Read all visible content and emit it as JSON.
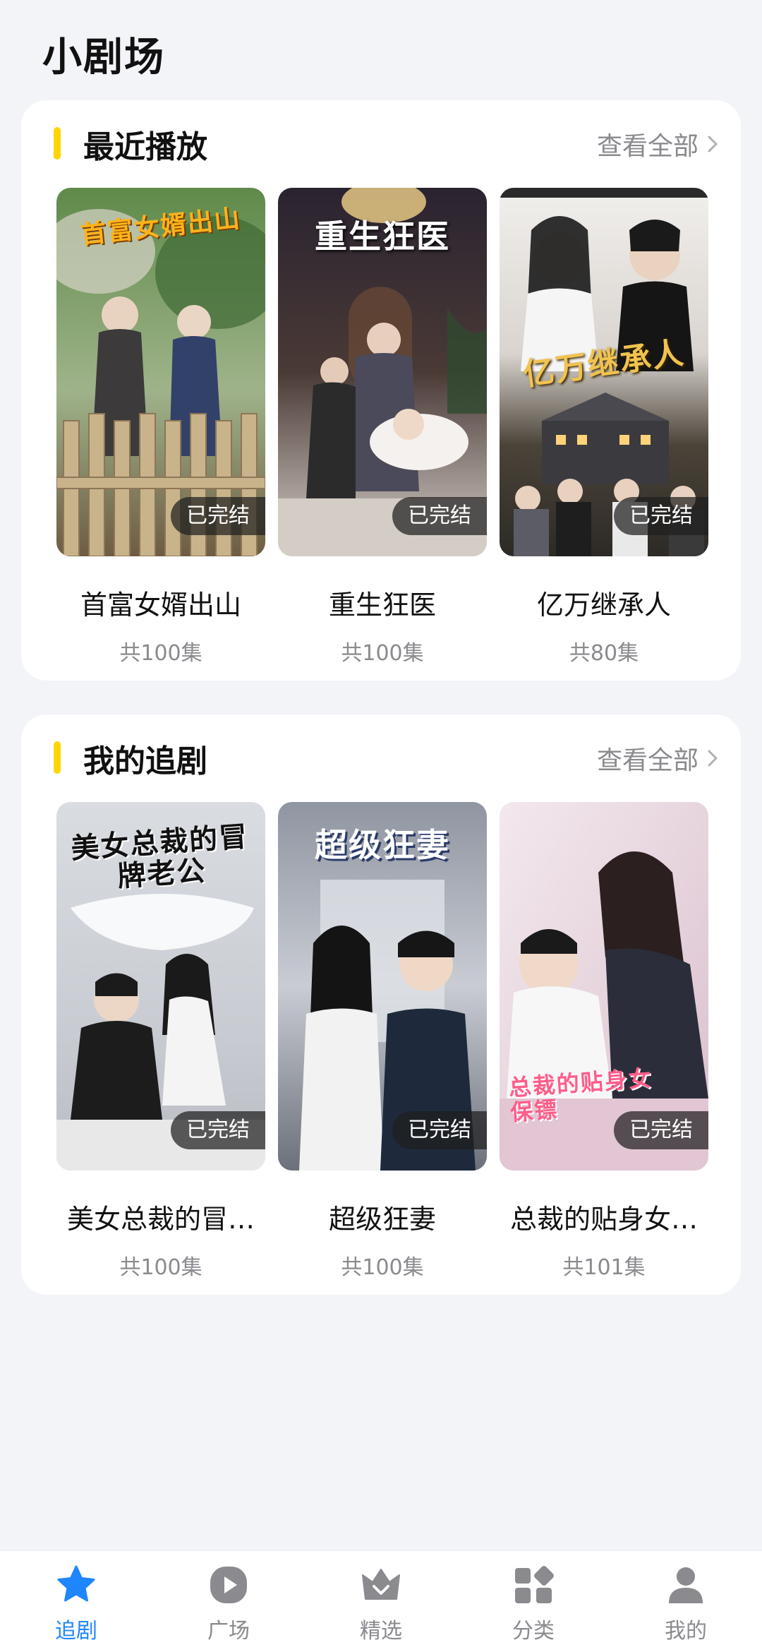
{
  "page_title": "小剧场",
  "sections": {
    "recent": {
      "title": "最近播放",
      "view_all": "查看全部",
      "items": [
        {
          "poster_text": "首富女婿出山",
          "badge": "已完结",
          "title": "首富女婿出山",
          "count": "共100集"
        },
        {
          "poster_text": "重生狂医",
          "badge": "已完结",
          "title": "重生狂医",
          "count": "共100集"
        },
        {
          "poster_text": "亿万继承人",
          "badge": "已完结",
          "title": "亿万继承人",
          "count": "共80集"
        }
      ]
    },
    "follow": {
      "title": "我的追剧",
      "view_all": "查看全部",
      "items": [
        {
          "poster_text": "美女总裁的冒牌老公",
          "badge": "已完结",
          "title": "美女总裁的冒…",
          "count": "共100集"
        },
        {
          "poster_text": "超级狂妻",
          "badge": "已完结",
          "title": "超级狂妻",
          "count": "共100集"
        },
        {
          "poster_text": "总裁的贴身女保镖",
          "badge": "已完结",
          "title": "总裁的贴身女…",
          "count": "共101集"
        }
      ]
    }
  },
  "tabbar": {
    "items": [
      {
        "label": "追剧",
        "icon": "star-icon",
        "active": true
      },
      {
        "label": "广场",
        "icon": "play-icon",
        "active": false
      },
      {
        "label": "精选",
        "icon": "crown-icon",
        "active": false
      },
      {
        "label": "分类",
        "icon": "grid-icon",
        "active": false
      },
      {
        "label": "我的",
        "icon": "person-icon",
        "active": false
      }
    ]
  },
  "colors": {
    "accent_bar": "#ffd400",
    "active_tab": "#1e86ff",
    "background": "#f3f4f8"
  }
}
